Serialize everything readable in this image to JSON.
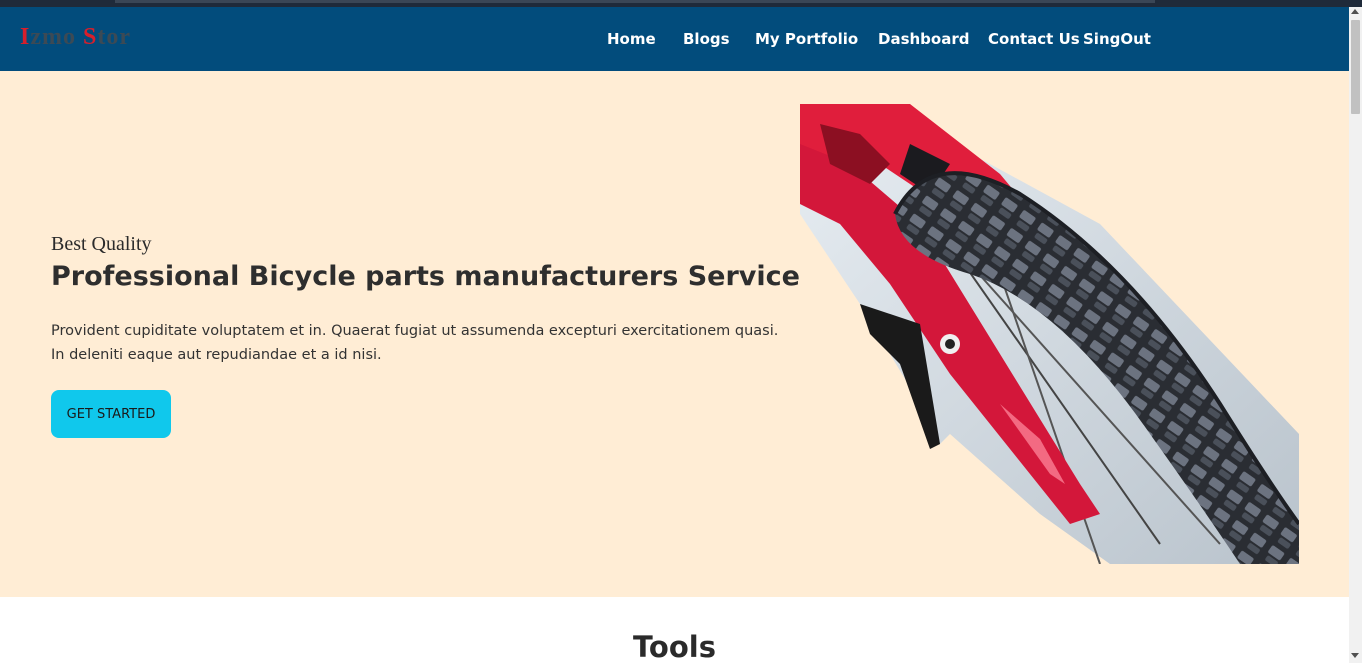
{
  "logo": {
    "part1": "I",
    "part2": "zmo ",
    "part3": "S",
    "part4": "tor"
  },
  "nav": {
    "items": [
      {
        "label": "Home"
      },
      {
        "label": "Blogs"
      },
      {
        "label": "My Portfolio"
      },
      {
        "label": "Dashboard"
      },
      {
        "label": "Contact Us"
      },
      {
        "label": "SingOut"
      }
    ]
  },
  "hero": {
    "eyebrow": "Best Quality",
    "headline": "Professional Bicycle parts manufacturers Service",
    "description": "Provident cupiditate voluptatem et in. Quaerat fugiat ut assumenda excepturi exercitationem quasi. In deleniti eaque aut repudiandae et a id nisi.",
    "cta_label": "GET STARTED",
    "image_icon": "bicycle-wheel-image"
  },
  "tools": {
    "title": "Tools"
  },
  "colors": {
    "navbar": "#024c7c",
    "hero_bg": "#ffedd5",
    "cta": "#10c8ec",
    "logo_accent": "#d61f2c"
  }
}
